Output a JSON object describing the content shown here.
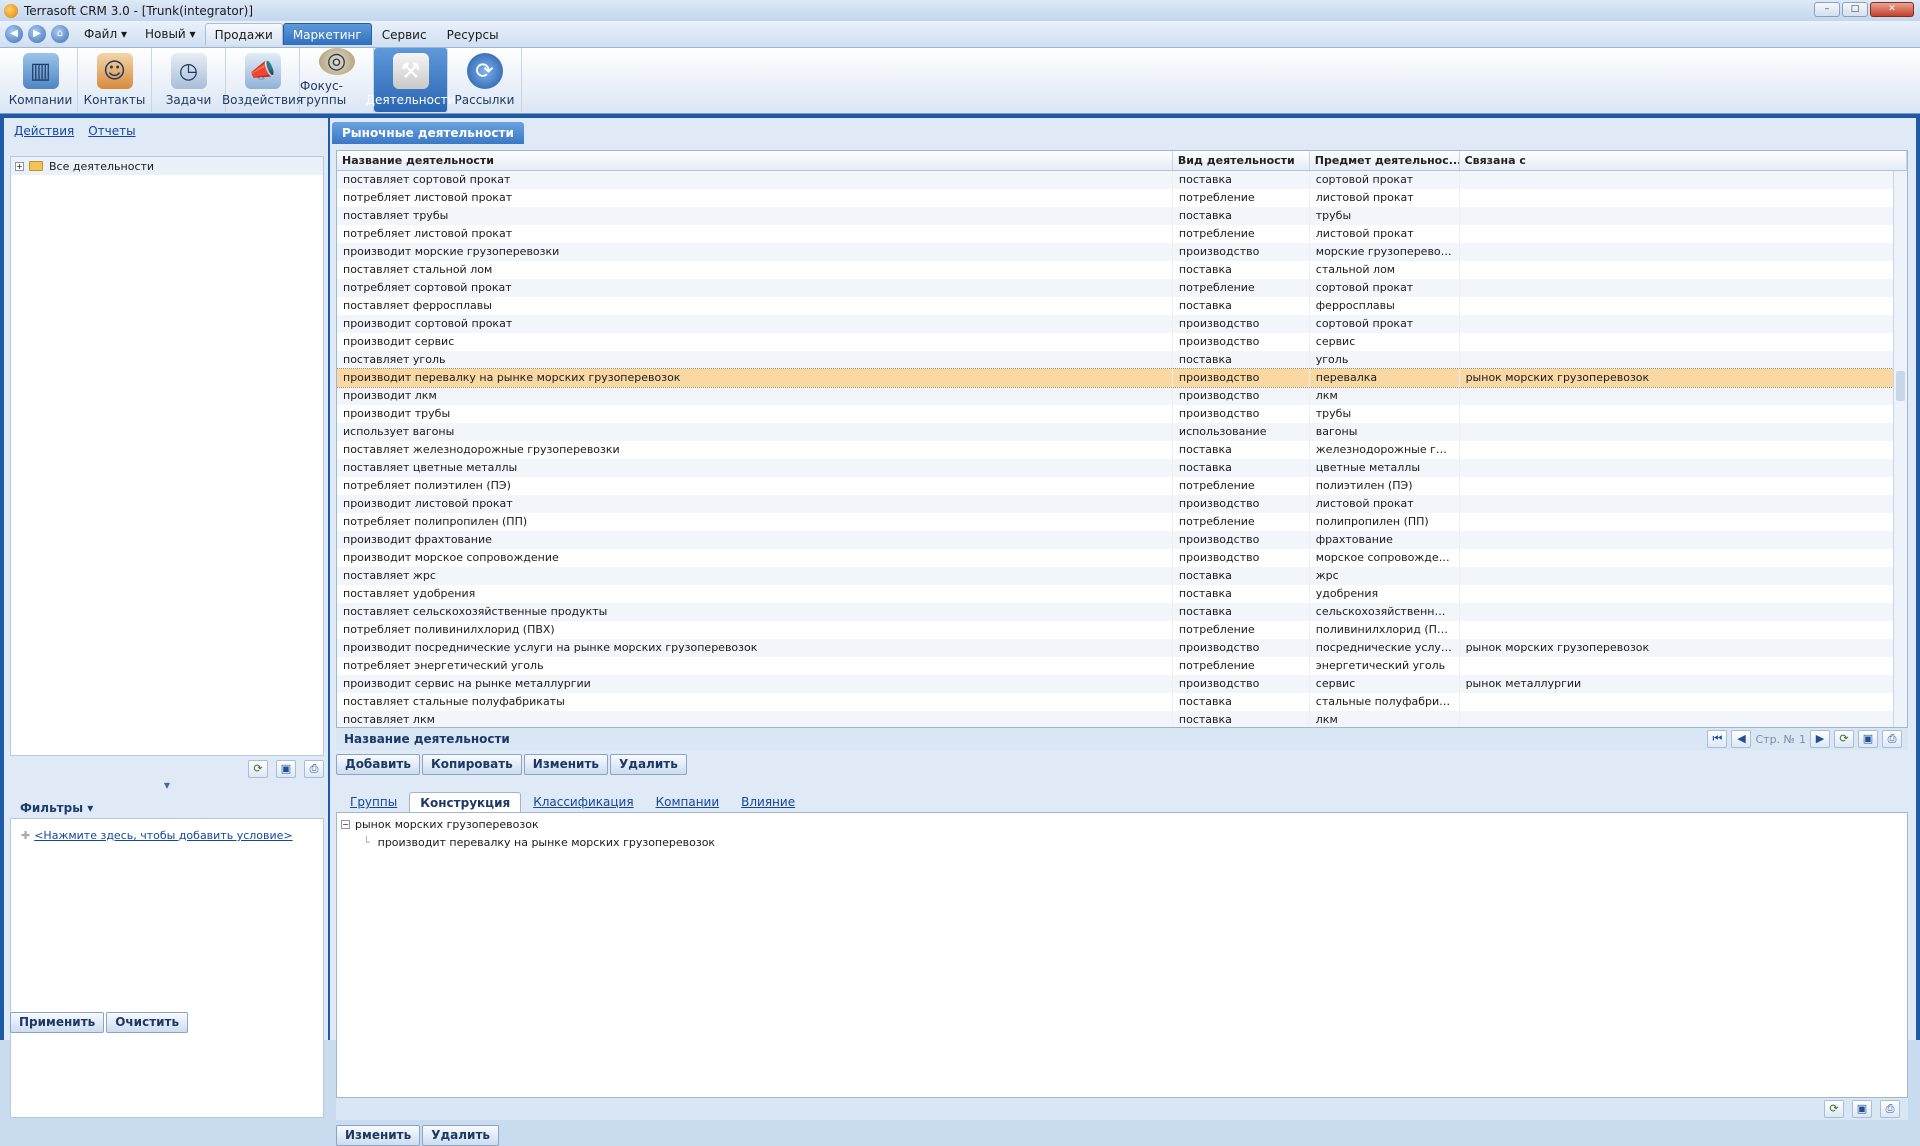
{
  "window": {
    "title": "Terrasoft CRM 3.0 - [Trunk(integrator)]"
  },
  "menu": {
    "file": "Файл ▾",
    "new": "Новый ▾",
    "tabs": [
      "Продажи",
      "Маркетинг",
      "Сервис",
      "Ресурсы"
    ],
    "selected_tab": "Маркетинг"
  },
  "ribbon": [
    {
      "label": "Компании",
      "icon": "companies-icon"
    },
    {
      "label": "Контакты",
      "icon": "contacts-icon"
    },
    {
      "label": "Задачи",
      "icon": "tasks-icon"
    },
    {
      "label": "Воздействия",
      "icon": "megaphone-icon"
    },
    {
      "label": "Фокус-группы",
      "icon": "focus-groups-icon"
    },
    {
      "label": "Деятельности",
      "icon": "tools-icon"
    },
    {
      "label": "Рассылки",
      "icon": "mailing-icon"
    }
  ],
  "ribbon_selected": "Деятельности",
  "left": {
    "links": [
      "Действия",
      "Отчеты"
    ],
    "tree_root": "Все деятельности",
    "filters_label": "Фильтры ▾",
    "filter_add": "<Нажмите здесь, чтобы добавить условие>",
    "apply": "Применить",
    "clear": "Очистить"
  },
  "main": {
    "tab": "Рыночные деятельности",
    "columns": [
      "Название деятельности",
      "Вид деятельности",
      "Предмет деятельнос...",
      "Связана с"
    ],
    "rows": [
      [
        "поставляет сортовой прокат",
        "поставка",
        "сортовой прокат",
        ""
      ],
      [
        "потребляет листовой прокат",
        "потребление",
        "листовой прокат",
        ""
      ],
      [
        "поставляет трубы",
        "поставка",
        "трубы",
        ""
      ],
      [
        "потребляет листовой прокат",
        "потребление",
        "листовой прокат",
        ""
      ],
      [
        "производит морские грузоперевозки",
        "производство",
        "морские грузоперевозки",
        ""
      ],
      [
        "поставляет стальной лом",
        "поставка",
        "стальной лом",
        ""
      ],
      [
        "потребляет сортовой прокат",
        "потребление",
        "сортовой прокат",
        ""
      ],
      [
        "поставляет ферросплавы",
        "поставка",
        "ферросплавы",
        ""
      ],
      [
        "производит сортовой прокат",
        "производство",
        "сортовой прокат",
        ""
      ],
      [
        "производит сервис",
        "производство",
        "сервис",
        ""
      ],
      [
        "поставляет уголь",
        "поставка",
        "уголь",
        ""
      ],
      [
        "производит перевалку на рынке морских грузоперевозок",
        "производство",
        "перевалка",
        "рынок морских грузоперевозок"
      ],
      [
        "производит лкм",
        "производство",
        "лкм",
        ""
      ],
      [
        "производит трубы",
        "производство",
        "трубы",
        ""
      ],
      [
        "использует вагоны",
        "использование",
        "вагоны",
        ""
      ],
      [
        "поставляет железнодорожные грузоперевозки",
        "поставка",
        "железнодорожные груз...",
        ""
      ],
      [
        "поставляет цветные металлы",
        "поставка",
        "цветные металлы",
        ""
      ],
      [
        "потребляет полиэтилен (ПЭ)",
        "потребление",
        "полиэтилен (ПЭ)",
        ""
      ],
      [
        "производит листовой прокат",
        "производство",
        "листовой прокат",
        ""
      ],
      [
        "потребляет полипропилен (ПП)",
        "потребление",
        "полипропилен (ПП)",
        ""
      ],
      [
        "производит фрахтование",
        "производство",
        "фрахтование",
        ""
      ],
      [
        "производит морское сопровождение",
        "производство",
        "морское сопровождение",
        ""
      ],
      [
        "поставляет жрс",
        "поставка",
        "жрс",
        ""
      ],
      [
        "поставляет удобрения",
        "поставка",
        "удобрения",
        ""
      ],
      [
        "поставляет сельскохозяйственные продукты",
        "поставка",
        "сельскохозяйственные ...",
        ""
      ],
      [
        "потребляет поливинилхлорид (ПВХ)",
        "потребление",
        "поливинилхлорид (ПВХ)",
        ""
      ],
      [
        "производит посреднические услуги на рынке морских грузоперевозок",
        "производство",
        "посреднические услуги",
        "рынок морских грузоперевозок"
      ],
      [
        "потребляет энергетический уголь",
        "потребление",
        "энергетический уголь",
        ""
      ],
      [
        "производит сервис на рынке металлургии",
        "производство",
        "сервис",
        "рынок металлургии"
      ],
      [
        "поставляет стальные полуфабрикаты",
        "поставка",
        "стальные полуфабрикаты",
        ""
      ],
      [
        "поставляет лкм",
        "поставка",
        "лкм",
        ""
      ]
    ],
    "selected_row": 11,
    "footer_label": "Название деятельности",
    "pager_text": "Стр. №",
    "page": "1",
    "actions": [
      "Добавить",
      "Копировать",
      "Изменить",
      "Удалить"
    ]
  },
  "detail": {
    "tabs": [
      "Группы",
      "Конструкция",
      "Классификация",
      "Компании",
      "Влияние"
    ],
    "selected_tab": "Конструкция",
    "tree_parent": "рынок морских грузоперевозок",
    "tree_child": "производит перевалку на рынке морских грузоперевозок",
    "actions": [
      "Изменить",
      "Удалить"
    ]
  }
}
